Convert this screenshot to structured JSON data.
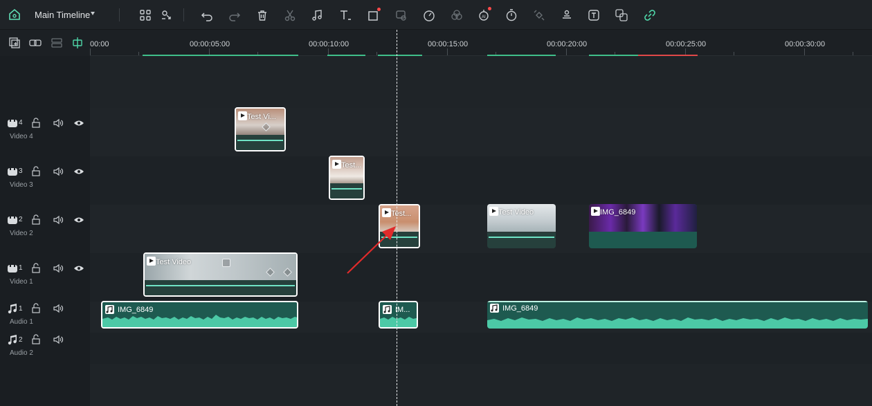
{
  "toolbar": {
    "title": "Main Timeline",
    "icons": [
      "apps-icon",
      "link-clips-icon",
      "undo-icon",
      "redo-icon",
      "delete-icon",
      "cut-icon",
      "audio-icon",
      "text-icon",
      "crop-icon",
      "mask-icon",
      "speed-icon",
      "color-icon",
      "ai-tools-icon",
      "timer-icon",
      "keyframe-icon",
      "stabilize-icon",
      "auto-text-icon",
      "translate-icon",
      "link-icon"
    ]
  },
  "ruler": {
    "ticks": [
      "00:00",
      "00:00:05:00",
      "00:00:10:00",
      "00:00:15:00",
      "00:00:20:00",
      "00:00:25:00",
      "00:00:30:00"
    ]
  },
  "tracks": [
    {
      "type": "video",
      "number": "4",
      "name": "Video 4"
    },
    {
      "type": "video",
      "number": "3",
      "name": "Video 3"
    },
    {
      "type": "video",
      "number": "2",
      "name": "Video 2"
    },
    {
      "type": "video",
      "number": "1",
      "name": "Video 1"
    },
    {
      "type": "audio",
      "number": "1",
      "name": "Audio 1"
    },
    {
      "type": "audio",
      "number": "2",
      "name": "Audio 2"
    }
  ],
  "clips": {
    "v4": "Test Vi...",
    "v3": "Test...",
    "v2a": "Test...",
    "v2b": "Test Video",
    "v2c": "IMG_6849",
    "v1": "Test Video",
    "a1a": "IMG_6849",
    "a1b": "IM...",
    "a1c": "IMG_6849"
  },
  "colors": {
    "accent": "#6fe3c5",
    "render_ok": "#3fbf8a",
    "render_bad": "#e04848",
    "annotation_arrow": "#e02b2b",
    "selection": "#ffffff"
  }
}
